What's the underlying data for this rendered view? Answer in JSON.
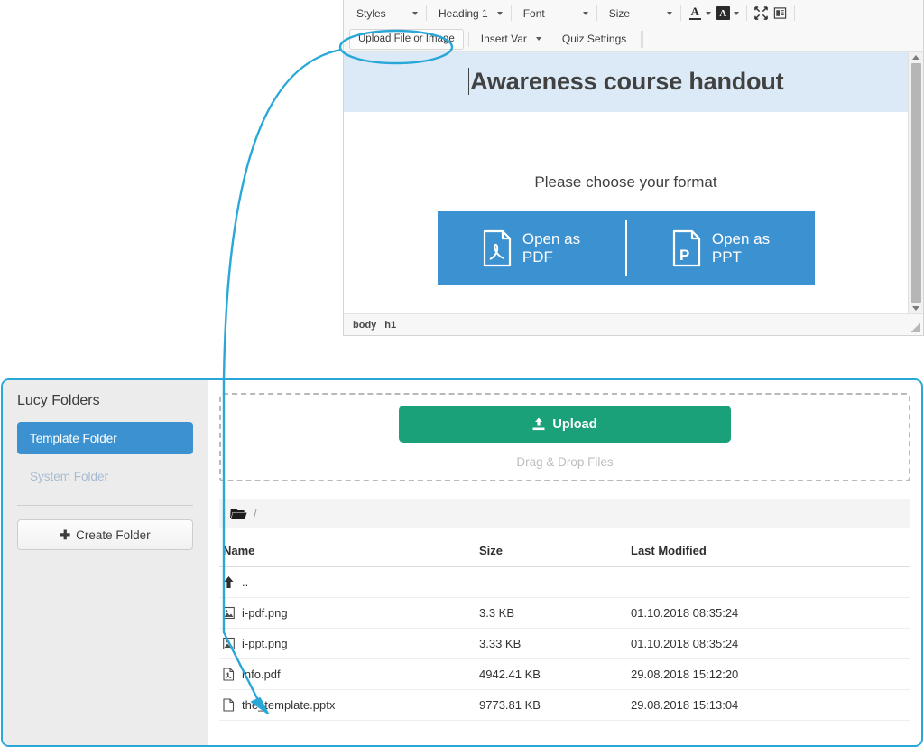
{
  "editor": {
    "toolbar": {
      "dropdowns": [
        {
          "name": "styles",
          "label": "Styles"
        },
        {
          "name": "heading",
          "label": "Heading 1"
        },
        {
          "name": "font",
          "label": "Font"
        },
        {
          "name": "size",
          "label": "Size"
        }
      ],
      "icons": [
        {
          "name": "text-color-icon",
          "glyph": "A"
        },
        {
          "name": "background-color-icon",
          "glyph": "A"
        },
        {
          "name": "maximize-icon",
          "glyph": "maximize"
        },
        {
          "name": "templates-icon",
          "glyph": "templates"
        }
      ],
      "buttons": [
        {
          "name": "upload-file-or-image",
          "label": "Upload File or Image",
          "highlighted": true
        },
        {
          "name": "insert-var",
          "label": "Insert Var",
          "has_caret": true
        },
        {
          "name": "quiz-settings",
          "label": "Quiz Settings",
          "has_caret": false
        }
      ]
    },
    "document": {
      "title": "Awareness course handout",
      "prompt": "Please choose your format",
      "format_buttons": [
        {
          "name": "open-as-pdf",
          "label": "Open as\nPDF",
          "line1": "Open as",
          "line2": "PDF",
          "icon": "pdf-file-icon"
        },
        {
          "name": "open-as-ppt",
          "label": "Open as\nPPT",
          "line1": "Open as",
          "line2": "PPT",
          "icon": "ppt-file-icon"
        }
      ],
      "band_color": "#dceaf8",
      "button_color": "#3c92d0"
    },
    "status_path": [
      "body",
      "h1"
    ]
  },
  "file_manager": {
    "sidebar": {
      "title": "Lucy Folders",
      "folders": [
        {
          "name": "template-folder",
          "label": "Template Folder",
          "active": true
        },
        {
          "name": "system-folder",
          "label": "System Folder",
          "active": false
        }
      ],
      "create_button": {
        "label": "Create Folder",
        "plus": "✚"
      }
    },
    "dropzone": {
      "upload_label": "Upload",
      "hint": "Drag & Drop Files",
      "upload_color": "#1aa179"
    },
    "breadcrumb": {
      "icon": "open-folder-icon",
      "path": "/"
    },
    "table": {
      "headers": [
        "Name",
        "Size",
        "Last Modified"
      ],
      "parent_row": {
        "label": "..",
        "icon": "arrow-up-icon"
      },
      "rows": [
        {
          "icon": "image-file-icon",
          "name": "i-pdf.png",
          "size": "3.3 KB",
          "modified": "01.10.2018 08:35:24"
        },
        {
          "icon": "image-file-icon",
          "name": "i-ppt.png",
          "size": "3.33 KB",
          "modified": "01.10.2018 08:35:24"
        },
        {
          "icon": "pdf-file-icon",
          "name": "info.pdf",
          "size": "4942.41 KB",
          "modified": "29.08.2018 15:12:20"
        },
        {
          "icon": "blank-file-icon",
          "name": "the_template.pptx",
          "size": "9773.81 KB",
          "modified": "29.08.2018 15:13:04"
        }
      ]
    }
  },
  "annotation": {
    "accent_color": "#29a8d8",
    "shapes": [
      "highlight-oval-upload-button",
      "curved-arrow-to-template-file",
      "panel-outline"
    ]
  }
}
